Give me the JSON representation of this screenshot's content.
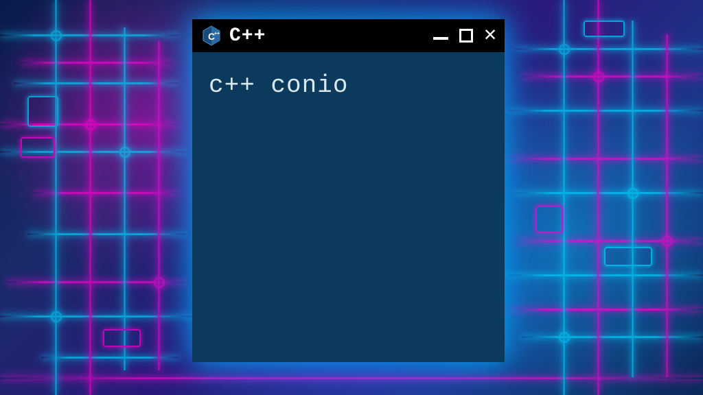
{
  "window": {
    "title": "C++",
    "icon_name": "cpp-logo"
  },
  "content": {
    "text": "c++ conio"
  },
  "colors": {
    "titlebar_bg": "#000000",
    "content_bg": "#0b3a5c",
    "glow_cyan": "#00d4ff",
    "glow_pink": "#ff00d4"
  }
}
